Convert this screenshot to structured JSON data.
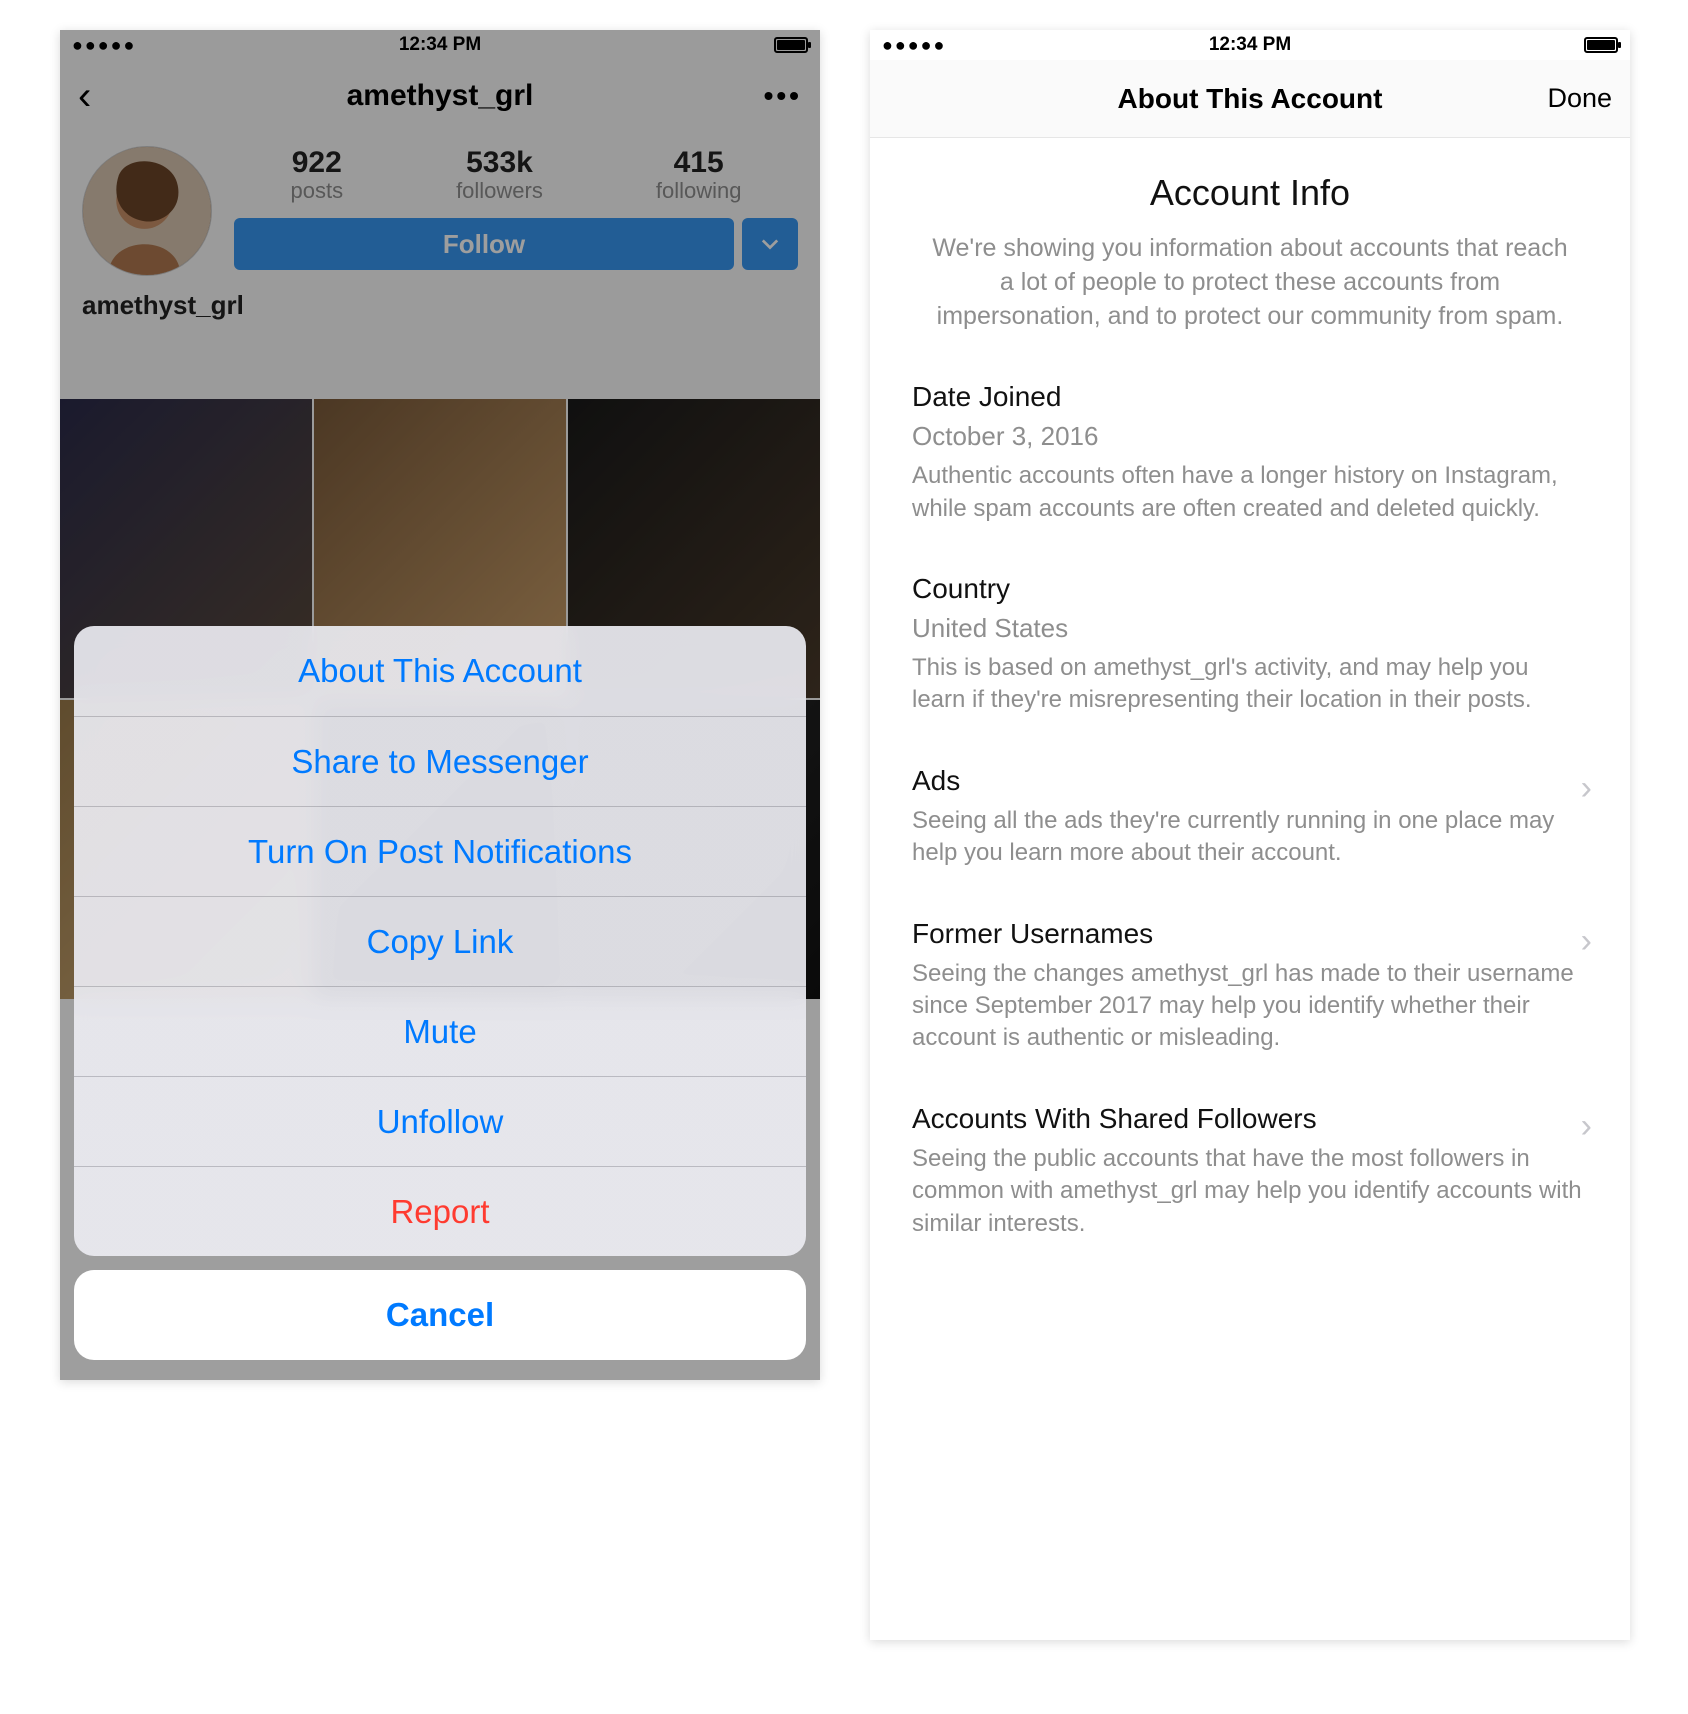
{
  "statusBar": {
    "time": "12:34 PM"
  },
  "left": {
    "nav": {
      "title": "amethyst_grl"
    },
    "profile": {
      "posts_num": "922",
      "posts_label": "posts",
      "followers_num": "533k",
      "followers_label": "followers",
      "following_num": "415",
      "following_label": "following",
      "follow_button": "Follow",
      "username": "amethyst_grl"
    },
    "sheet": {
      "items": [
        "About This Account",
        "Share to Messenger",
        "Turn On Post Notifications",
        "Copy Link",
        "Mute",
        "Unfollow",
        "Report"
      ],
      "cancel": "Cancel"
    }
  },
  "right": {
    "nav": {
      "title": "About This Account",
      "done": "Done"
    },
    "info_title": "Account Info",
    "info_sub": "We're showing you information about accounts that reach a lot of people to protect these accounts from impersonation, and to protect our community from spam.",
    "sections": {
      "date_joined": {
        "title": "Date Joined",
        "value": "October 3, 2016",
        "desc": "Authentic accounts often have a longer history on Instagram, while spam accounts are often created and deleted quickly."
      },
      "country": {
        "title": "Country",
        "value": "United States",
        "desc": "This is based on amethyst_grl's activity, and may help you learn if they're misrepresenting their location in their posts."
      },
      "ads": {
        "title": "Ads",
        "desc": "Seeing all the ads they're currently running in one place may help you learn more about their account."
      },
      "former": {
        "title": "Former Usernames",
        "desc": "Seeing the changes amethyst_grl has made to their username since September 2017 may help you identify whether their account is authentic or misleading."
      },
      "shared": {
        "title": "Accounts With Shared Followers",
        "desc": "Seeing the public accounts that have the most followers in common with amethyst_grl may help you identify accounts with similar interests."
      }
    }
  }
}
